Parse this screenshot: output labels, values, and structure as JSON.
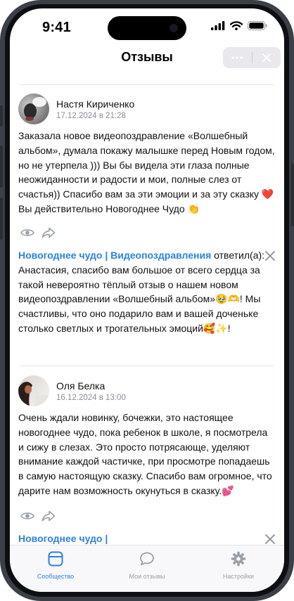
{
  "status_bar": {
    "time": "9:41"
  },
  "header": {
    "title": "Отзывы"
  },
  "reviews": [
    {
      "author": "Настя Кириченко",
      "date": "17.12.2024 в 21:28",
      "text": "Заказала новое видеопоздравление «Волшебный альбом», думала покажу малышке перед Новым годом, но не утерпела ))) Вы бы видела эти глаза полные неожиданности и радости и мои, полные слез от счастья)) Спасибо вам за эти эмоции и за эту сказку ❤️ Вы действительно Новогоднее Чудо 👏",
      "reply": {
        "community": "Новогоднее чудо | Видеопоздравления",
        "verb": "ответил(а):",
        "text": "Анастасия, спасибо вам большое от всего сердца за такой невероятно тёплый отзыв о нашем новом видеопоздравлении «Волшебный альбом»🥹🫶! Мы счастливы, что оно подарило вам и вашей доченьке столько светлых и трогательных эмоций🥰✨!"
      }
    },
    {
      "author": "Оля Белка",
      "date": "16.12.2024 в 13:00",
      "text": "Очень ждали новинку, бочежки, это настоящее новогоднее чудо, пока ребенок в школе, я посмотрела и сижу в слезах. Это просто потрясающе, уделяют внимание каждой частичке, при просмотре попадаешь в самую настоящую сказку. Спасибо вам огромное, что дарите нам возможность окунуться в сказку.💕",
      "reply": {
        "community": "Новогоднее чудо |"
      }
    }
  ],
  "tabbar": [
    {
      "label": "Сообщество",
      "icon": "community-icon",
      "active": true
    },
    {
      "label": "Мои отзывы",
      "icon": "chat-bubble-icon",
      "active": false
    },
    {
      "label": "Настройки",
      "icon": "gear-icon",
      "active": false
    }
  ],
  "colors": {
    "accent": "#2d81e0",
    "muted": "#8a8f99",
    "frame": "#3b3f47"
  }
}
